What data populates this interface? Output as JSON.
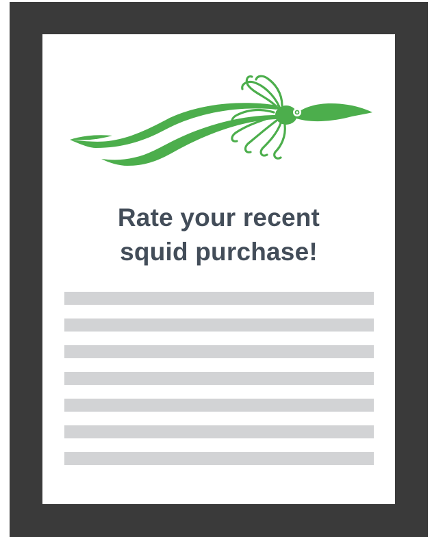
{
  "headline": {
    "line1": "Rate your recent",
    "line2": "squid purchase!"
  },
  "colors": {
    "frame": "#3a3a3a",
    "card": "#ffffff",
    "accent": "#4cae4c",
    "text": "#434d59",
    "placeholder": "#d2d3d5"
  },
  "illustration": {
    "icon": "squid-icon"
  },
  "placeholder_lines": 7
}
